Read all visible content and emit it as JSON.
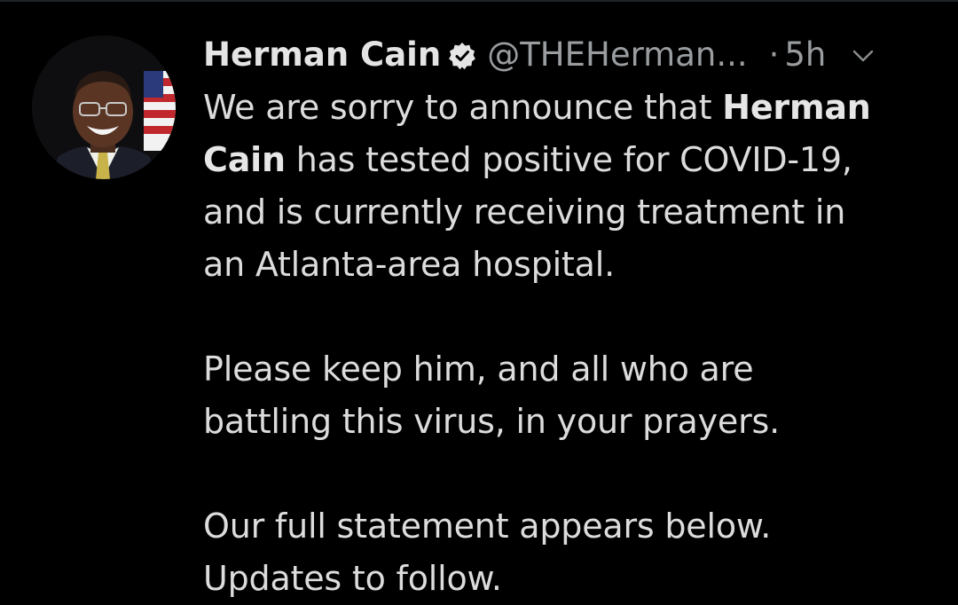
{
  "tweet": {
    "display_name": "Herman Cain",
    "handle": "@THEHerman...",
    "separator": "·",
    "time": "5h",
    "body": {
      "p1_l1_a": "We are sorry to announce that ",
      "p1_l1_b": "Herman",
      "p1_l2_a": "Cain",
      "p1_l2_b": " has tested positive for COVID-19,",
      "p1_l3": "and is currently receiving treatment in",
      "p1_l4": "an Atlanta-area hospital.",
      "p2_l1": "Please keep him, and all who are",
      "p2_l2": "battling this virus, in your prayers.",
      "p3_l1": "Our full statement appears below.",
      "p3_l2": "Updates to follow."
    }
  },
  "icons": {
    "verified": "verified-badge-icon",
    "menu": "chevron-down-icon"
  },
  "colors": {
    "background": "#000000",
    "text": "#dcdcdc",
    "secondary_text": "#9a9da0"
  }
}
